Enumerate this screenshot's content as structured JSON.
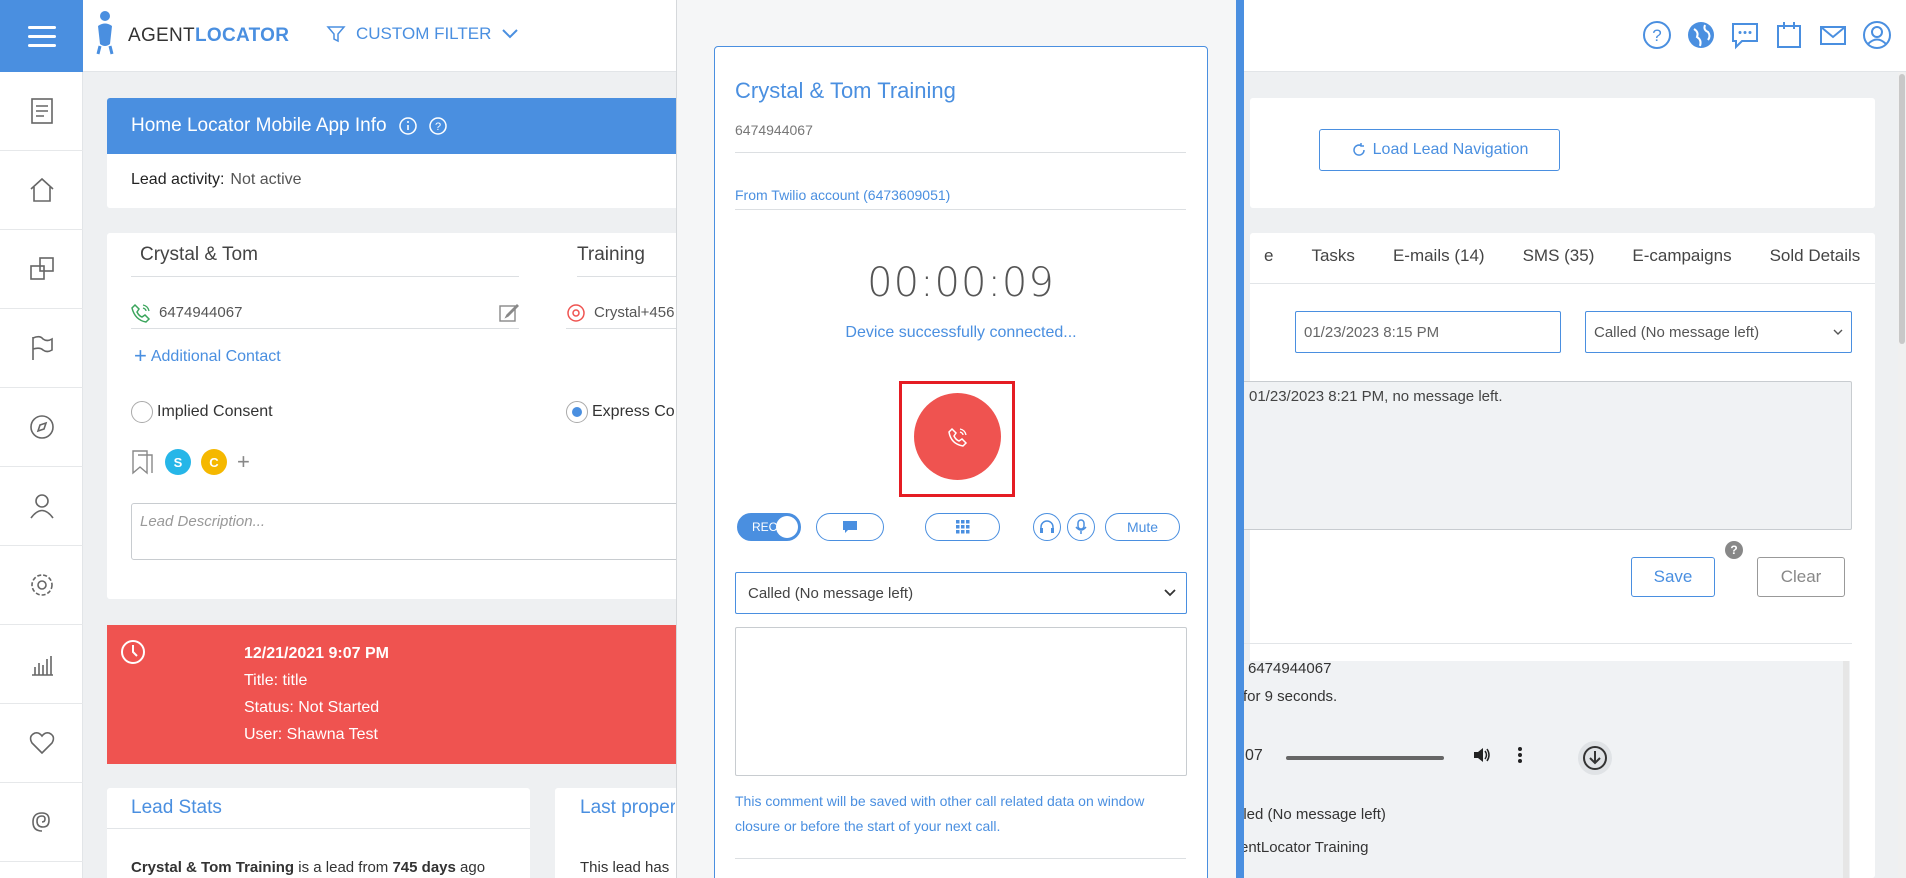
{
  "topbar": {
    "logo_agent": "AGENT",
    "logo_locator": "LOCATOR",
    "filter_label": "CUSTOM FILTER",
    "icons": [
      "help-icon",
      "globe-icon",
      "chat-icon",
      "calendar-icon",
      "mail-icon",
      "user-icon"
    ]
  },
  "sidebar": {
    "icons": [
      "document-icon",
      "home-icon",
      "copy-icon",
      "flag-icon",
      "compass-icon",
      "person-icon",
      "gear-icon",
      "chart-icon",
      "heart-icon",
      "spiral-icon"
    ]
  },
  "app_info": {
    "title": "Home Locator Mobile App Info",
    "lead_activity_label": "Lead activity:",
    "lead_activity_value": "Not active"
  },
  "contact": {
    "name": "Crystal & Tom",
    "training_label": "Training",
    "phone": "6474944067",
    "email_partial": "Crystal+456",
    "add_contact": "Additional Contact",
    "implied_consent": "Implied Consent",
    "express_consent": "Express Co",
    "tags": [
      "S",
      "C"
    ],
    "description_placeholder": "Lead Description..."
  },
  "task": {
    "date": "12/21/2021 9:07 PM",
    "title": "Title: title",
    "status": "Status: Not Started",
    "user": "User: Shawna Test"
  },
  "lead_stats": {
    "title": "Lead Stats",
    "text_prefix": "Crystal & Tom Training",
    "text_mid": " is a lead from ",
    "text_days": "745 days",
    "text_suffix": " ago"
  },
  "last_property": {
    "title": "Last proper",
    "text": "This lead has"
  },
  "right": {
    "load_nav": "Load Lead Navigation",
    "tabs": [
      "e",
      "Tasks",
      "E-mails (14)",
      "SMS (35)",
      "E-campaigns",
      "Sold Details"
    ],
    "date_value": "01/23/2023 8:15 PM",
    "status_value": "Called (No message left)",
    "notes": "01/23/2023 8:21 PM, no message left.",
    "save": "Save",
    "clear": "Clear",
    "help": "?",
    "log_line1": "6474944067",
    "log_line2": "for 9 seconds.",
    "audio_time": "07",
    "log_line3": "lled (No message left)",
    "log_line4": "entLocator Training"
  },
  "dialer": {
    "name": "Crystal & Tom Training",
    "number": "6474944067",
    "twilio": "From Twilio account (6473609051)",
    "timer": "00:00:09",
    "status": "Device successfully connected...",
    "rec_label": "REC",
    "mute_label": "Mute",
    "outcome": "Called (No message left)",
    "comment_note": "This comment will be saved with other call related data on window closure or before the start of your next call."
  },
  "colors": {
    "primary": "#4a8fe0",
    "task_red": "#ef5350",
    "highlight_red": "#e51c23"
  }
}
